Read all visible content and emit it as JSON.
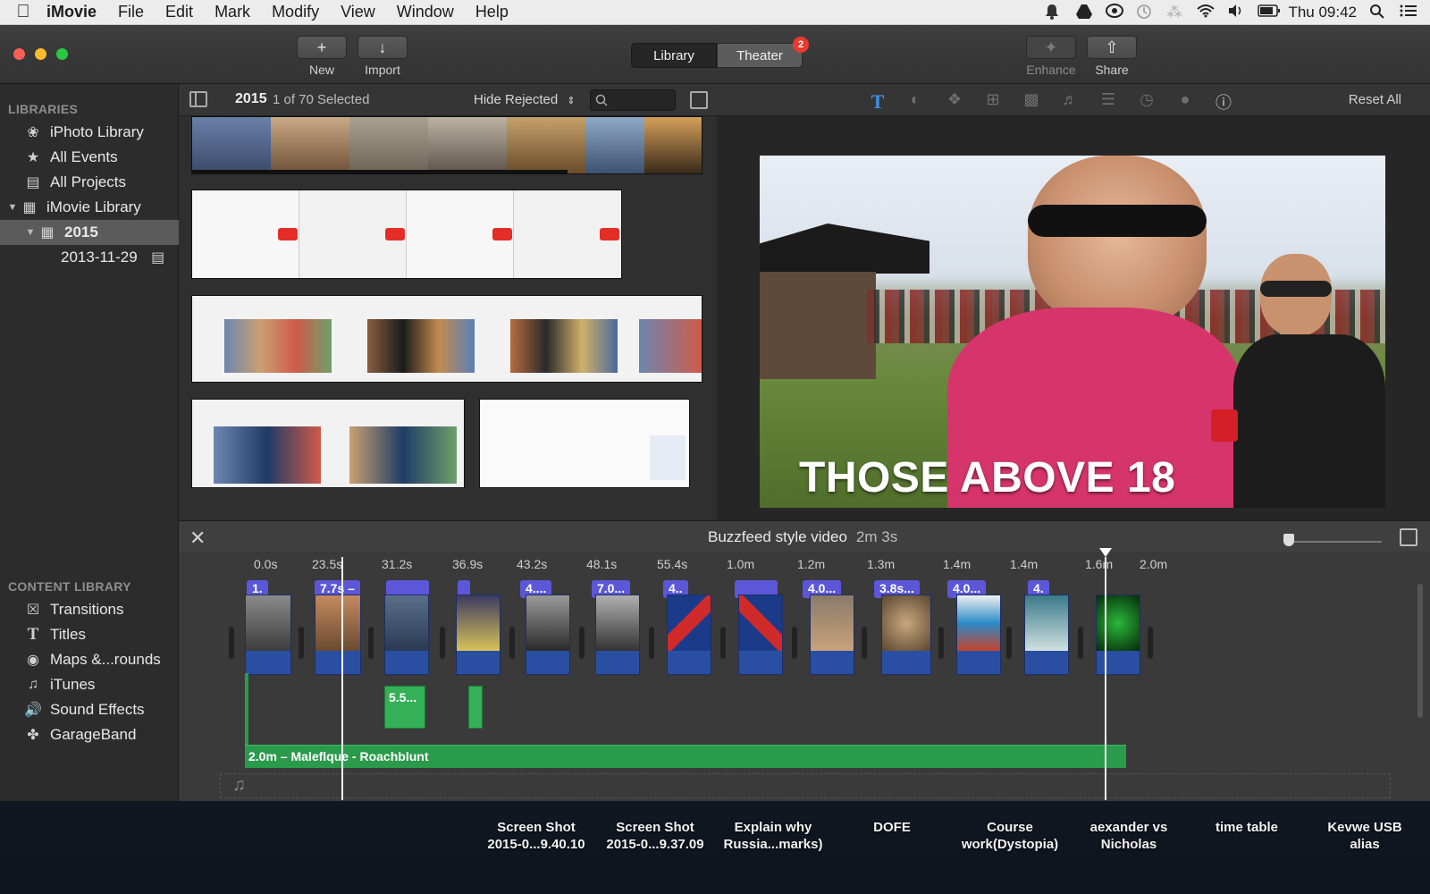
{
  "menubar": {
    "app_name": "iMovie",
    "items": [
      "File",
      "Edit",
      "Mark",
      "Modify",
      "View",
      "Window",
      "Help"
    ],
    "clock": "Thu 09:42"
  },
  "toolbar": {
    "new_label": "New",
    "import_label": "Import",
    "library_tab": "Library",
    "theater_tab": "Theater",
    "theater_badge": "2",
    "enhance_label": "Enhance",
    "share_label": "Share"
  },
  "sidebar": {
    "libraries_header": "LIBRARIES",
    "items": [
      {
        "label": "iPhoto Library",
        "icon": "palm-tree-icon"
      },
      {
        "label": "All Events",
        "icon": "star-icon"
      },
      {
        "label": "All Projects",
        "icon": "clapper-icon"
      },
      {
        "label": "iMovie Library",
        "icon": "grid-icon"
      },
      {
        "label": "2015",
        "icon": "calendar-icon"
      },
      {
        "label": "2013-11-29",
        "icon": "clapper-icon"
      }
    ],
    "content_header": "CONTENT LIBRARY",
    "content_items": [
      {
        "label": "Transitions",
        "icon": "transition-icon"
      },
      {
        "label": "Titles",
        "icon": "t-icon"
      },
      {
        "label": "Maps &...rounds",
        "icon": "globe-icon"
      },
      {
        "label": "iTunes",
        "icon": "music-note-icon"
      },
      {
        "label": "Sound Effects",
        "icon": "speaker-icon"
      },
      {
        "label": "GarageBand",
        "icon": "guitar-icon"
      }
    ]
  },
  "browser": {
    "year": "2015",
    "selection": "1 of 70 Selected",
    "filter": "Hide Rejected"
  },
  "viewer": {
    "reset_all": "Reset All",
    "overlay_title": "THOSE ABOVE 18"
  },
  "timeline": {
    "project_name": "Buzzfeed style video",
    "duration": "2m 3s",
    "ticks": [
      "0.0s",
      "23.5s",
      "31.2s",
      "36.9s",
      "43.2s",
      "48.1s",
      "55.4s",
      "1.0m",
      "1.2m",
      "1.3m",
      "1.4m",
      "1.4m",
      "1.6m",
      "2.0m"
    ],
    "title_labels": [
      "1.",
      "7.7s –",
      "4....",
      "7.0...",
      "4..",
      "4.0...",
      "3.8s...",
      "4.0...",
      "4."
    ],
    "green_clip_label": "5.5...",
    "audio_label": "2.0m – Maleflque - Roachblunt"
  },
  "desktop": {
    "items": [
      "Screen Shot\n2015-0...9.40.10",
      "Screen Shot\n2015-0...9.37.09",
      "Explain why\nRussia...marks)",
      "DOFE",
      "Course\nwork(Dystopia)",
      "aexander vs\nNicholas",
      "time table",
      "Kevwe USB\nalias"
    ]
  }
}
